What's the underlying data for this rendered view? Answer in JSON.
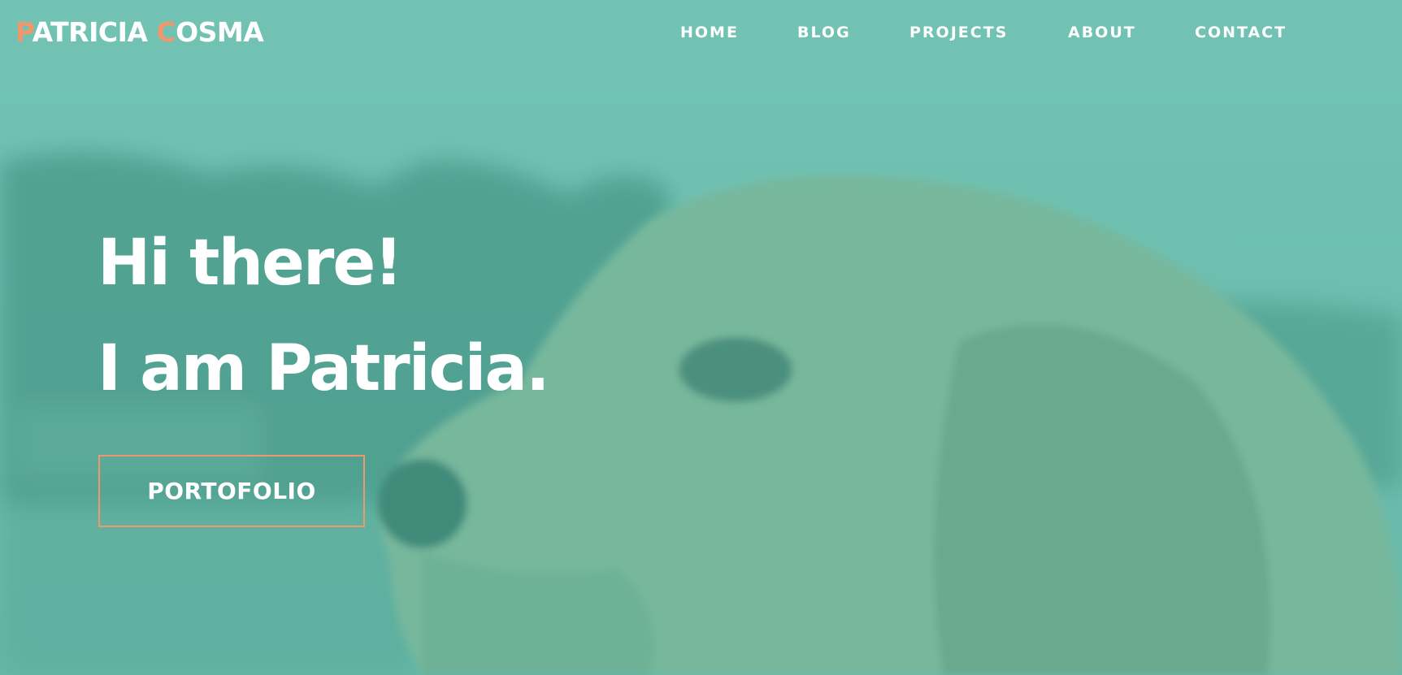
{
  "header": {
    "logo": {
      "first_initial": "P",
      "first_rest": "ATRICIA ",
      "last_initial": "C",
      "last_rest": "OSMA"
    },
    "nav": {
      "home": "HOME",
      "blog": "BLOG",
      "projects": "PROJECTS",
      "about": "ABOUT",
      "contact": "CONTACT"
    }
  },
  "hero": {
    "greeting": "Hi there!",
    "intro": "I am Patricia.",
    "cta_label": "PORTOFOLIO",
    "background_image": "golden-retriever-dog-photo"
  },
  "colors": {
    "overlay": "#67bcac",
    "accent": "#f0976d",
    "text": "#ffffff"
  }
}
